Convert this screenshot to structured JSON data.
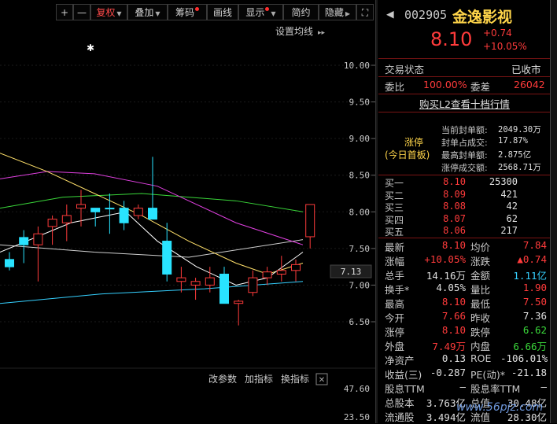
{
  "toolbar": {
    "plus": "+",
    "minus": "—",
    "fuquan": "复权",
    "diejia": "叠加",
    "chouma": "筹码",
    "huaxian": "画线",
    "xianshi": "显示",
    "jianyue": "简约",
    "yincang": "隐藏",
    "fullscreen": "⛶"
  },
  "chart": {
    "settings_label": "设置均线",
    "star": "✱",
    "price_ticks": [
      "10.00",
      "9.50",
      "9.00",
      "8.50",
      "8.00",
      "7.50",
      "7.00",
      "6.50"
    ],
    "current_price_tag": "7.13",
    "indicator_tools": {
      "change_params": "改参数",
      "add_indicator": "加指标",
      "swap_indicator": "换指标",
      "close": "✕"
    },
    "indicator_ticks": [
      "47.60",
      "23.50"
    ]
  },
  "chart_data": {
    "type": "candlestick",
    "ylim": [
      6.3,
      10.2
    ],
    "candles": [
      {
        "o": 7.35,
        "h": 7.45,
        "l": 7.2,
        "c": 7.25,
        "up": false
      },
      {
        "o": 7.65,
        "h": 7.75,
        "l": 7.3,
        "c": 7.55,
        "up": false
      },
      {
        "o": 7.55,
        "h": 7.8,
        "l": 7.05,
        "c": 7.7,
        "up": true
      },
      {
        "o": 7.8,
        "h": 7.95,
        "l": 7.55,
        "c": 7.9,
        "up": true
      },
      {
        "o": 7.85,
        "h": 8.1,
        "l": 7.6,
        "c": 7.95,
        "up": true
      },
      {
        "o": 8.05,
        "h": 8.3,
        "l": 7.8,
        "c": 8.1,
        "up": true
      },
      {
        "o": 8.05,
        "h": 8.05,
        "l": 7.8,
        "c": 8.0,
        "up": false
      },
      {
        "o": 8.05,
        "h": 8.25,
        "l": 7.7,
        "c": 8.05,
        "up": false
      },
      {
        "o": 8.05,
        "h": 8.15,
        "l": 7.75,
        "c": 7.85,
        "up": false
      },
      {
        "o": 7.95,
        "h": 8.1,
        "l": 7.9,
        "c": 8.05,
        "up": true
      },
      {
        "o": 8.05,
        "h": 8.75,
        "l": 7.9,
        "c": 7.9,
        "up": false
      },
      {
        "o": 7.6,
        "h": 7.85,
        "l": 7.05,
        "c": 7.15,
        "up": false
      },
      {
        "o": 7.1,
        "h": 7.25,
        "l": 6.9,
        "c": 7.05,
        "up": true
      },
      {
        "o": 7.0,
        "h": 7.1,
        "l": 6.8,
        "c": 7.05,
        "up": true
      },
      {
        "o": 7.0,
        "h": 7.25,
        "l": 6.9,
        "c": 7.1,
        "up": true
      },
      {
        "o": 7.15,
        "h": 7.25,
        "l": 6.8,
        "c": 6.75,
        "up": false
      },
      {
        "o": 6.75,
        "h": 6.8,
        "l": 6.45,
        "c": 6.78,
        "up": true
      },
      {
        "o": 6.9,
        "h": 7.2,
        "l": 6.85,
        "c": 7.1,
        "up": true
      },
      {
        "o": 7.1,
        "h": 7.25,
        "l": 7.0,
        "c": 7.18,
        "up": true
      },
      {
        "o": 7.15,
        "h": 7.4,
        "l": 7.05,
        "c": 7.2,
        "up": true
      },
      {
        "o": 7.2,
        "h": 7.35,
        "l": 7.05,
        "c": 7.28,
        "up": true
      },
      {
        "o": 7.66,
        "h": 8.1,
        "l": 7.5,
        "c": 8.1,
        "up": true
      }
    ],
    "colors": {
      "up": "#ff3b3b",
      "down": "#29e3ff",
      "ma5": "#ffffff",
      "ma10": "#ffe06a",
      "ma20": "#e040e0",
      "ma60": "#3ad83a",
      "ma120": "#35d0ff",
      "ma250": "#cfcfcf"
    }
  },
  "quote": {
    "code": "002905",
    "name": "金逸影视",
    "price": "8.10",
    "change": "+0.74",
    "change_pct": "+10.05%",
    "status_label": "交易状态",
    "status_value": "已收市",
    "weibi_label": "委比",
    "weibi_value": "100.00%",
    "weicha_label": "委差",
    "weicha_value": "26042",
    "l2_link": "购买L2查看十档行情",
    "limit_tag_line1": "涨停",
    "limit_tag_line2": "(今日首板)",
    "seal_rows": [
      {
        "label": "当前封单额:",
        "value": "2049.30万"
      },
      {
        "label": "封单占成交:",
        "value": "17.87%"
      },
      {
        "label": "最高封单额:",
        "value": "2.875亿"
      },
      {
        "label": "涨停成交额:",
        "value": "2568.71万"
      }
    ],
    "buys": [
      {
        "label": "买一",
        "price": "8.10",
        "vol": "25300"
      },
      {
        "label": "买二",
        "price": "8.09",
        "vol": "421"
      },
      {
        "label": "买三",
        "price": "8.08",
        "vol": "42"
      },
      {
        "label": "买四",
        "price": "8.07",
        "vol": "62"
      },
      {
        "label": "买五",
        "price": "8.06",
        "vol": "217"
      }
    ],
    "stats": [
      {
        "l1": "最新",
        "v1": "8.10",
        "c1": "red",
        "l2": "均价",
        "v2": "7.84",
        "c2": "red"
      },
      {
        "l1": "涨幅",
        "v1": "+10.05%",
        "c1": "red",
        "l2": "涨跌",
        "v2": "▲0.74",
        "c2": "red"
      },
      {
        "l1": "总手",
        "v1": "14.16万",
        "c1": "white",
        "l2": "金额",
        "v2": "1.11亿",
        "c2": "blue"
      },
      {
        "l1": "换手*",
        "v1": "4.05%",
        "c1": "white",
        "l2": "量比",
        "v2": "1.90",
        "c2": "red"
      },
      {
        "l1": "最高",
        "v1": "8.10",
        "c1": "red",
        "l2": "最低",
        "v2": "7.50",
        "c2": "red"
      },
      {
        "l1": "今开",
        "v1": "7.66",
        "c1": "red",
        "l2": "昨收",
        "v2": "7.36",
        "c2": "white"
      },
      {
        "l1": "涨停",
        "v1": "8.10",
        "c1": "red",
        "l2": "跌停",
        "v2": "6.62",
        "c2": "green"
      },
      {
        "l1": "外盘",
        "v1": "7.49万",
        "c1": "red",
        "l2": "内盘",
        "v2": "6.66万",
        "c2": "green"
      },
      {
        "l1": "净资产",
        "v1": "0.13",
        "c1": "white",
        "l2": "ROE",
        "v2": "-106.01%",
        "c2": "white"
      },
      {
        "l1": "收益(三)",
        "v1": "-0.287",
        "c1": "white",
        "l2": "PE(动)*",
        "v2": "-21.18",
        "c2": "white"
      },
      {
        "l1": "股息TTM",
        "v1": "—",
        "c1": "white",
        "l2": "股息率TTM",
        "v2": "—",
        "c2": "white"
      },
      {
        "l1": "总股本",
        "v1": "3.763亿",
        "c1": "white",
        "l2": "总值",
        "v2": "30.48亿",
        "c2": "white"
      },
      {
        "l1": "流通股",
        "v1": "3.494亿",
        "c1": "white",
        "l2": "流值",
        "v2": "28.30亿",
        "c2": "white"
      }
    ]
  },
  "watermark": "www.56pjz.com"
}
